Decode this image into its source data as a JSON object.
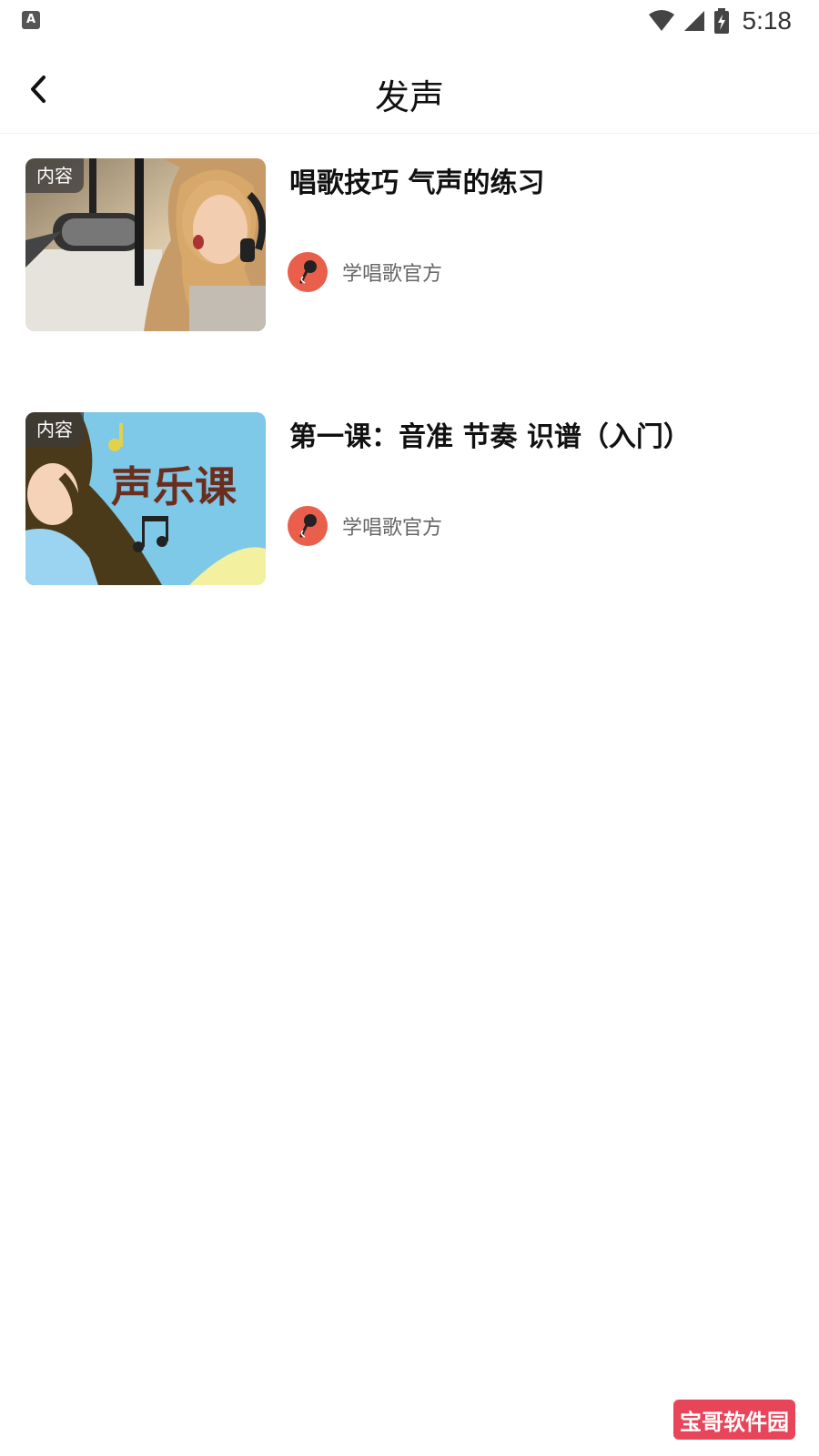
{
  "status_bar": {
    "time": "5:18",
    "app_icon": "A"
  },
  "header": {
    "title": "发声",
    "back_icon": "chevron-left-icon"
  },
  "items": [
    {
      "badge": "内容",
      "title": "唱歌技巧 气声的练习",
      "author": "学唱歌官方"
    },
    {
      "badge": "内容",
      "title": "第一课：音准 节奏 识谱（入门）",
      "author": "学唱歌官方",
      "thumb_text": "声乐课"
    }
  ],
  "watermark": "宝哥软件园",
  "colors": {
    "avatar": "#e95f4b",
    "watermark": "#e9455a",
    "thumb2_bg": "#7ec8e8"
  }
}
